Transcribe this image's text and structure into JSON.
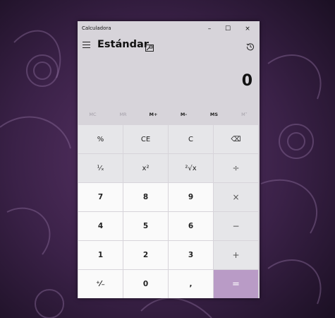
{
  "colors": {
    "wallpaper_base": "#2a1a35",
    "window_bg": "#d7d4da",
    "function_key_bg": "#e6e6e9",
    "number_key_bg": "#fafafa",
    "equals_accent": "#b99bc6"
  },
  "window": {
    "title": "Calculadora",
    "minimize_glyph": "–",
    "maximize_glyph": "☐",
    "close_glyph": "×"
  },
  "header": {
    "mode": "Estándar",
    "menu_icon": "hamburger-icon",
    "keep_on_top_icon": "keep-on-top-icon",
    "history_icon": "history-icon"
  },
  "display": {
    "value": "0"
  },
  "memory": [
    {
      "label": "MC",
      "enabled": false
    },
    {
      "label": "MR",
      "enabled": false
    },
    {
      "label": "M+",
      "enabled": true
    },
    {
      "label": "M-",
      "enabled": true
    },
    {
      "label": "MS",
      "enabled": true
    },
    {
      "label": "M˅",
      "enabled": false
    }
  ],
  "keys": {
    "percent": "%",
    "ce": "CE",
    "clear": "C",
    "backspace": "⌫",
    "reciprocal": "¹⁄ₓ",
    "square": "x²",
    "sqrt": "²√x",
    "divide": "÷",
    "seven": "7",
    "eight": "8",
    "nine": "9",
    "multiply": "×",
    "four": "4",
    "five": "5",
    "six": "6",
    "minus": "−",
    "one": "1",
    "two": "2",
    "three": "3",
    "plus": "+",
    "negate": "⁺⁄₋",
    "zero": "0",
    "decimal": ",",
    "equals": "="
  }
}
